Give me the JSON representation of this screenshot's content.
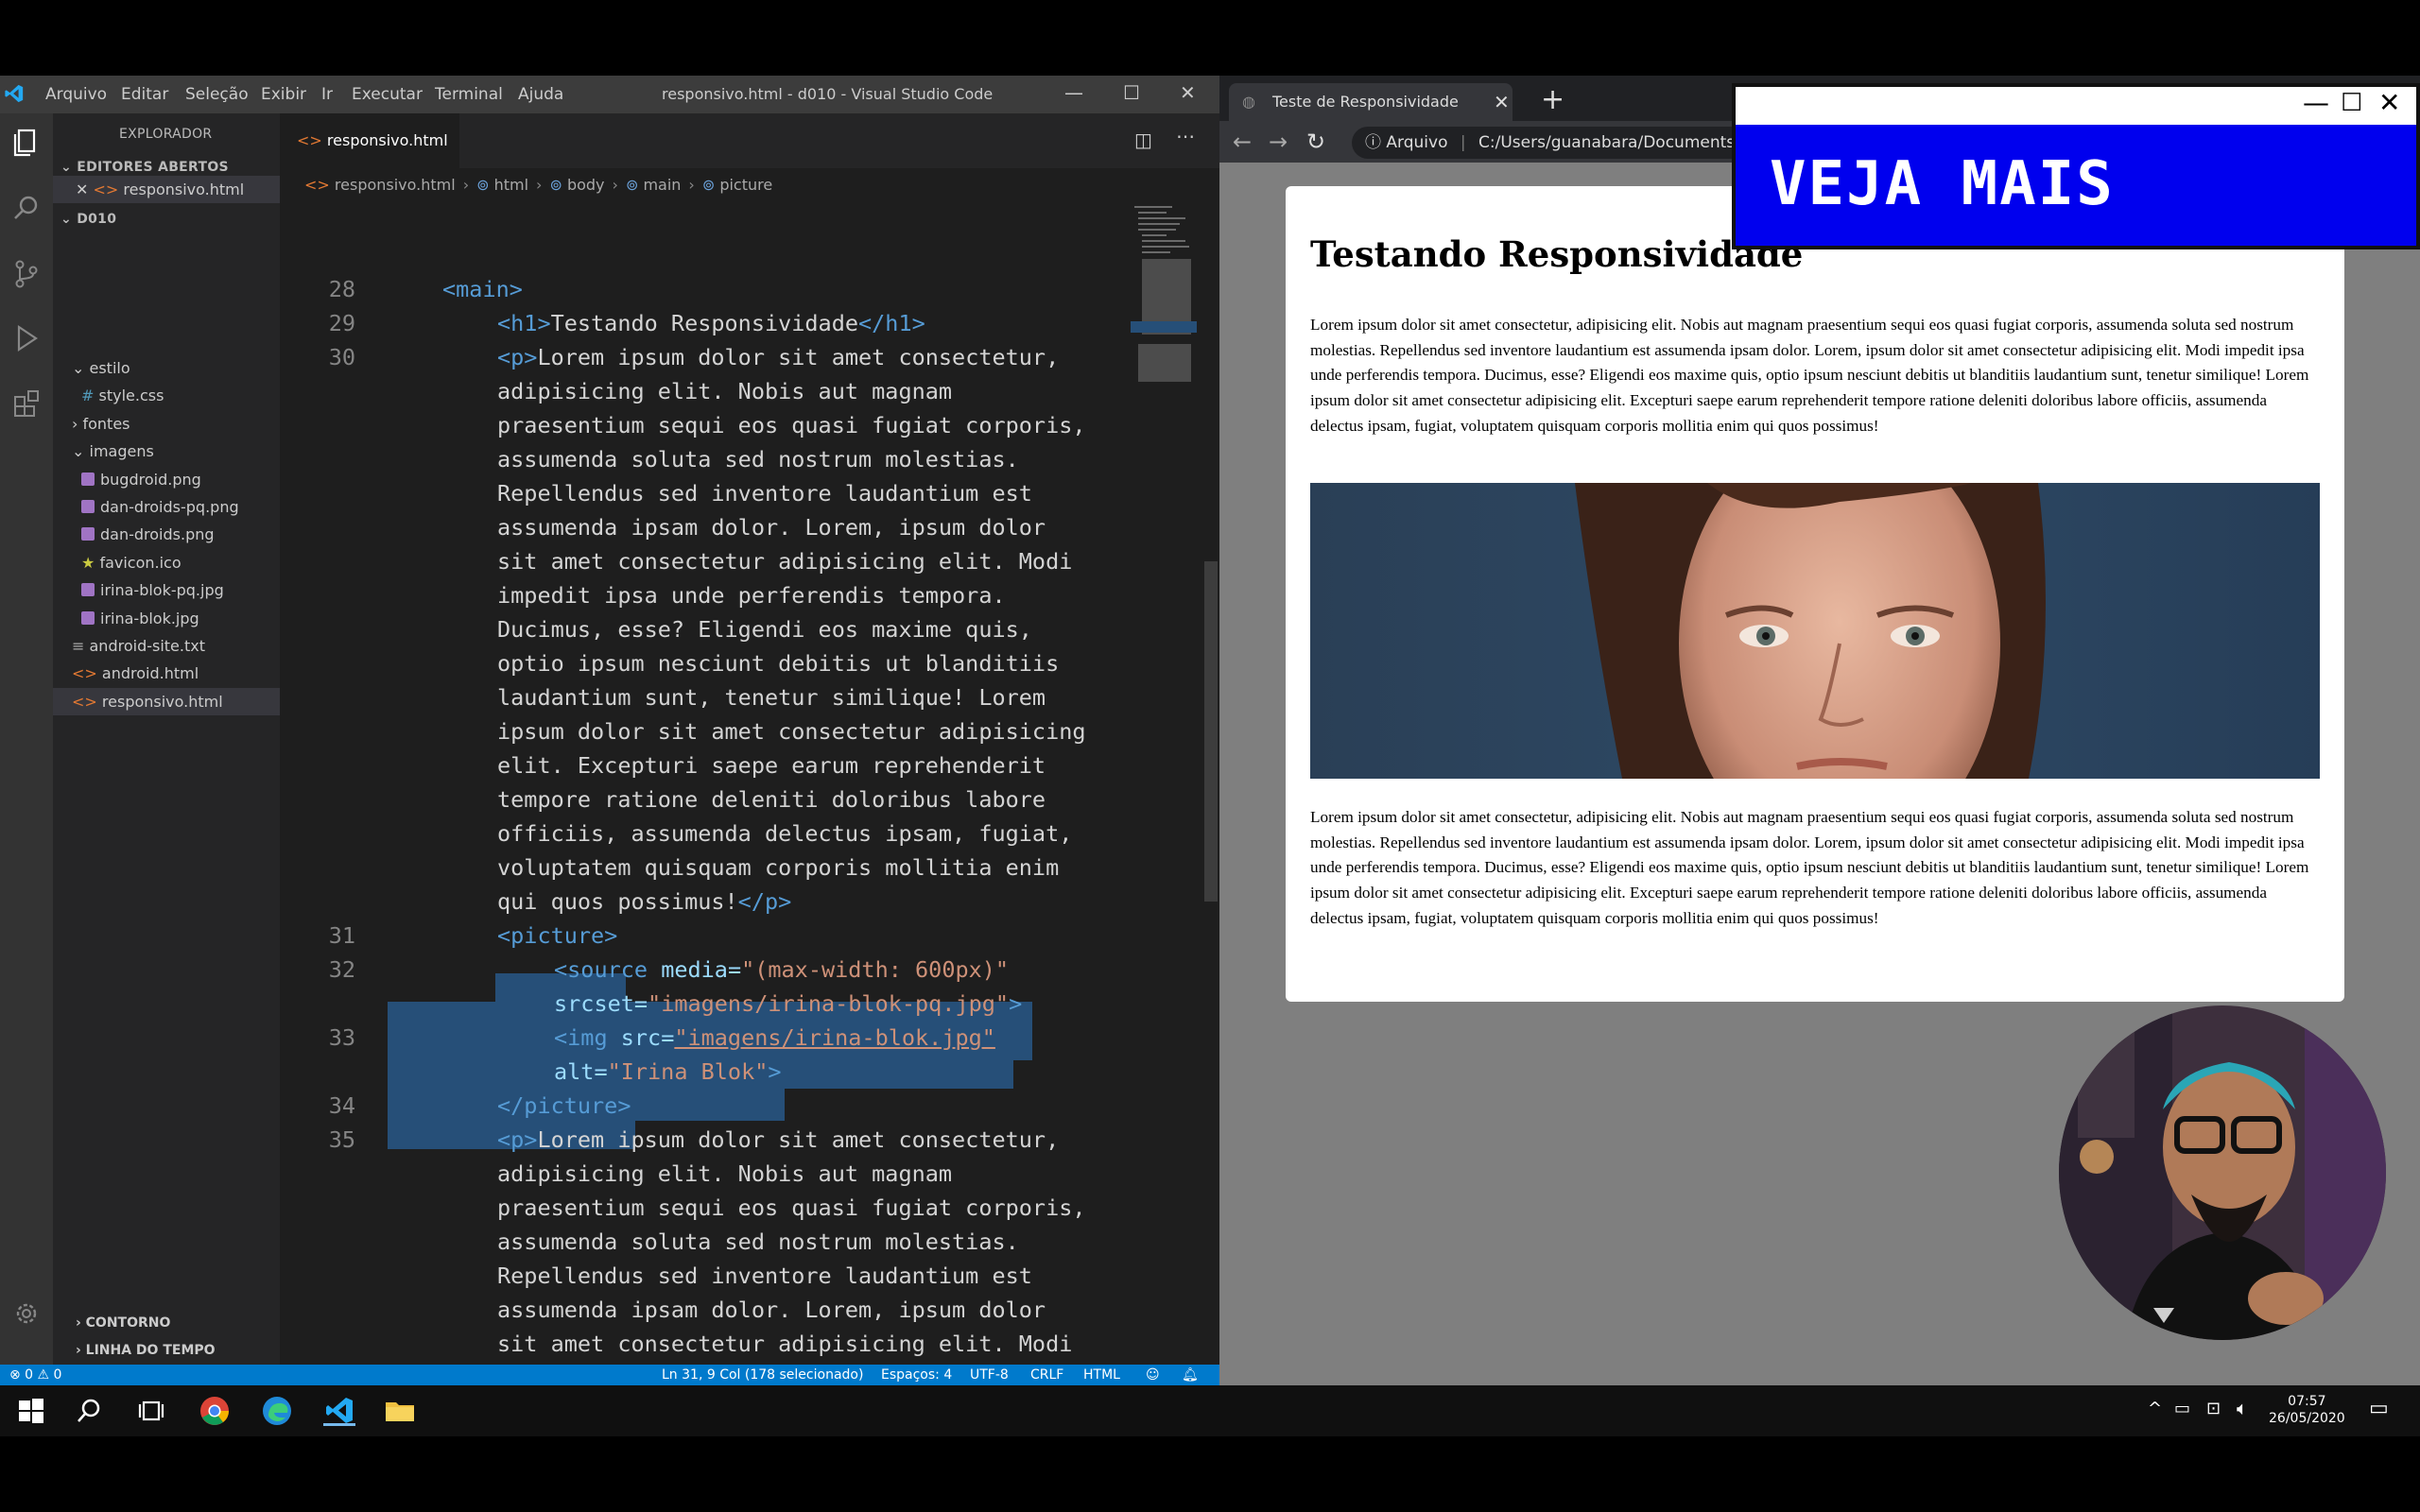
{
  "vscode": {
    "menu": [
      "Arquivo",
      "Editar",
      "Seleção",
      "Exibir",
      "Ir",
      "Executar",
      "Terminal",
      "Ajuda"
    ],
    "window_title": "responsivo.html - d010 - Visual Studio Code",
    "explorer_title": "EXPLORADOR",
    "open_editors_title": "EDITORES ABERTOS",
    "open_editor_file": "responsivo.html",
    "folder_name": "D010",
    "tree": [
      {
        "label": "estilo",
        "kind": "folder-open"
      },
      {
        "label": "style.css",
        "kind": "css"
      },
      {
        "label": "fontes",
        "kind": "folder"
      },
      {
        "label": "imagens",
        "kind": "folder-open"
      },
      {
        "label": "bugdroid.png",
        "kind": "image"
      },
      {
        "label": "dan-droids-pq.png",
        "kind": "image"
      },
      {
        "label": "dan-droids.png",
        "kind": "image"
      },
      {
        "label": "favicon.ico",
        "kind": "star"
      },
      {
        "label": "irina-blok-pq.jpg",
        "kind": "image"
      },
      {
        "label": "irina-blok.jpg",
        "kind": "image"
      },
      {
        "label": "android-site.txt",
        "kind": "txt"
      },
      {
        "label": "android.html",
        "kind": "html"
      },
      {
        "label": "responsivo.html",
        "kind": "html"
      }
    ],
    "outline_label": "CONTORNO",
    "timeline_label": "LINHA DO TEMPO",
    "tab_label": "responsivo.html",
    "breadcrumb": [
      "responsivo.html",
      "html",
      "body",
      "main",
      "picture"
    ],
    "line_numbers": [
      "28",
      "29",
      "30",
      "31",
      "32",
      "33",
      "34",
      "35"
    ],
    "status": {
      "problems": "⊗ 0 ⚠ 0",
      "position": "Ln 31, 9 Col (178 selecionado)",
      "spaces": "Espaços: 4",
      "encoding": "UTF-8",
      "eol": "CRLF",
      "language": "HTML"
    }
  },
  "code": {
    "main_open": "<main>",
    "h1_open": "<h1>",
    "h1_text": "Testando Responsividade",
    "h1_close": "</h1>",
    "p_open": "<p>",
    "p_close": "</p>",
    "lorem_lines": [
      "Lorem ipsum dolor sit amet consectetur,",
      "adipisicing elit. Nobis aut magnam",
      "praesentium sequi eos quasi fugiat corporis,",
      "assumenda soluta sed nostrum molestias.",
      "Repellendus sed inventore laudantium est",
      "assumenda ipsam dolor. Lorem, ipsum dolor",
      "sit amet consectetur adipisicing elit. Modi",
      "impedit ipsa unde perferendis tempora.",
      "Ducimus, esse? Eligendi eos maxime quis,",
      "optio ipsum nesciunt debitis ut blanditiis",
      "laudantium sunt, tenetur similique! Lorem",
      "ipsum dolor sit amet consectetur adipisicing",
      "elit. Excepturi saepe earum reprehenderit",
      "tempore ratione deleniti doloribus labore",
      "officiis, assumenda delectus ipsam, fugiat,",
      "voluptatem quisquam corporis mollitia enim",
      "qui quos possimus!"
    ],
    "picture_open": "<picture>",
    "source_tag": "<source",
    "media_attr": "media=",
    "media_val": "\"(max-width: 600px)\"",
    "srcset_attr": "srcset=",
    "srcset_val": "\"imagens/irina-blok-pq.jpg\"",
    "gt": ">",
    "img_tag": "<img",
    "src_attr": "src=",
    "src_val": "\"imagens/irina-blok.jpg\"",
    "alt_attr": "alt=",
    "alt_val": "\"Irina Blok\"",
    "picture_close": "</picture>"
  },
  "browser": {
    "tab_title": "Teste de Responsividade",
    "secure_label": "Arquivo",
    "url": "C:/Users/guanabara/Documents/e",
    "page_heading": "Testando Responsividade",
    "paragraph": "Lorem ipsum dolor sit amet consectetur, adipisicing elit. Nobis aut magnam praesentium sequi eos quasi fugiat corporis, assumenda soluta sed nostrum molestias. Repellendus sed inventore laudantium est assumenda ipsam dolor. Lorem, ipsum dolor sit amet consectetur adipisicing elit. Modi impedit ipsa unde perferendis tempora. Ducimus, esse? Eligendi eos maxime quis, optio ipsum nesciunt debitis ut blanditiis laudantium sunt, tenetur similique! Lorem ipsum dolor sit amet consectetur adipisicing elit. Excepturi saepe earum reprehenderit tempore ratione deleniti doloribus labore officiis, assumenda delectus ipsam, fugiat, voluptatem quisquam corporis mollitia enim qui quos possimus!"
  },
  "overlay": {
    "banner_text": "VEJA MAIS"
  },
  "taskbar": {
    "time": "07:57",
    "date": "26/05/2020"
  },
  "colors": {
    "vscode_bg": "#1e1e1e",
    "statusbar": "#007acc",
    "selection": "#264f78",
    "banner": "#0000ee"
  }
}
